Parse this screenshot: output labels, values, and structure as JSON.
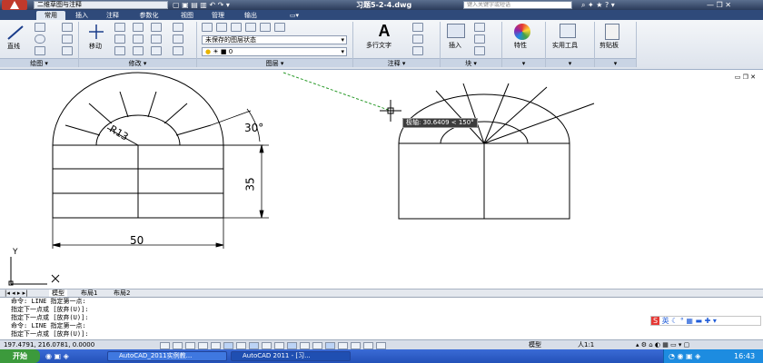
{
  "app": {
    "workspace": "二维草图与注释",
    "title": "习题5-2-4.dwg",
    "search_placeholder": "键入关键字或短语"
  },
  "menu_tabs": [
    "常用",
    "插入",
    "注释",
    "参数化",
    "视图",
    "管理",
    "输出"
  ],
  "ribbon": {
    "line_label": "直线",
    "move_label": "移动",
    "layer_state": "未保存的图层状态",
    "layer_current": "0",
    "mtext_label": "多行文字",
    "insert_label": "插入",
    "properties_label": "特性",
    "utilities_label": "实用工具",
    "clipboard_label": "剪贴板",
    "panels": [
      "绘图",
      "修改",
      "图层",
      "注释",
      "块"
    ]
  },
  "drawing": {
    "dim_radius": "R13",
    "dim_angle": "30°",
    "dim_height": "35",
    "dim_width": "50",
    "tooltip": "极轴: 30.6409 < 150°",
    "ucs_x": "X",
    "ucs_y": "Y"
  },
  "layout_tabs": [
    "模型",
    "布局1",
    "布局2"
  ],
  "command_lines": [
    "命令:  LINE 指定第一点:",
    "指定下一点或 [放弃(U)]:",
    "指定下一点或 [放弃(U)]:",
    "命令:  LINE 指定第一点:",
    "指定下一点或 [放弃(U)]:"
  ],
  "ime": {
    "lang": "英"
  },
  "status": {
    "coords": "197.4791, 216.0781, 0.0000",
    "model": "模型",
    "scale": "人1:1"
  },
  "taskbar": {
    "start": "开始",
    "task1": "AutoCAD_2011实例教...",
    "task2": "AutoCAD 2011 - [习...",
    "clock": "16:43"
  },
  "colors": {
    "titlebar": "#2b3b5a",
    "menutabs": "#2f4a7a",
    "taskbar": "#2451b8",
    "tooltip_bg": "#3c3c3c",
    "polar_track": "#2a9a2a"
  }
}
